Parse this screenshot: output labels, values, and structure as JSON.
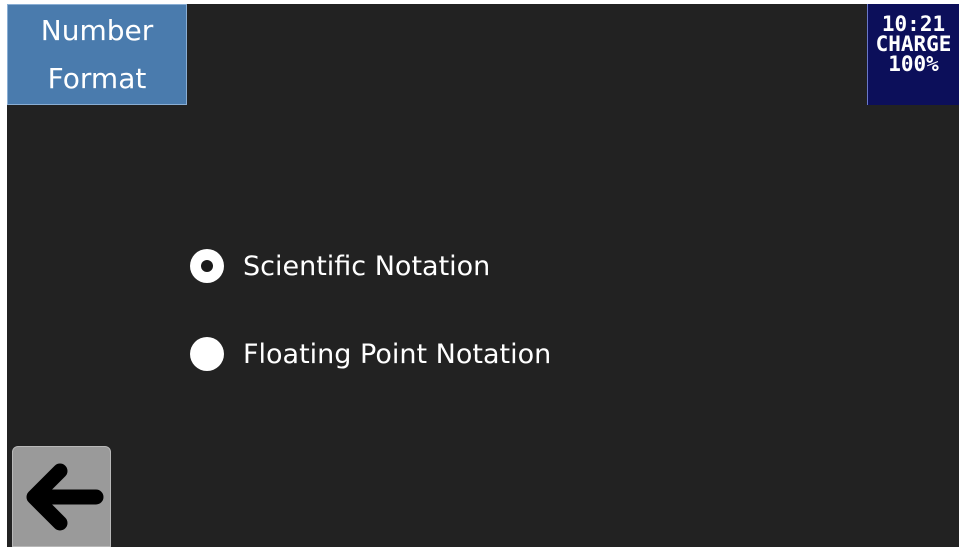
{
  "header": {
    "title_line1": "Number",
    "title_line2": "Format",
    "title_bg_color": "#4a7bad"
  },
  "status": {
    "time": "10:21",
    "charge_label": "CHARGE",
    "charge_level": "100%",
    "bg_color": "#0c0f5a"
  },
  "options": [
    {
      "label": "Scientific Notation",
      "selected": true
    },
    {
      "label": "Floating Point Notation",
      "selected": false
    }
  ],
  "back_button": {
    "icon": "arrow-left-icon"
  }
}
